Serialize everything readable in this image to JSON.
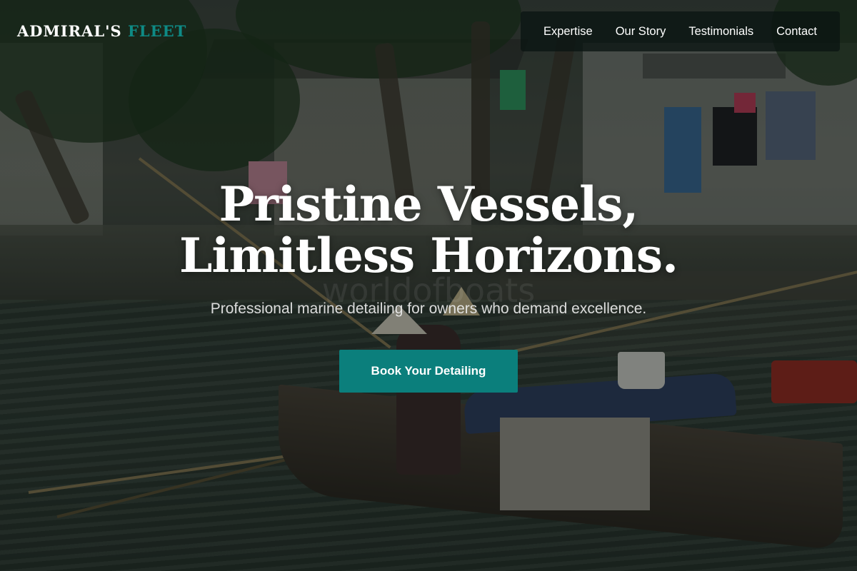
{
  "brand": {
    "logo_main": "ADMIRAL'S",
    "logo_accent": "FLEET",
    "accent_color": "#0e8a85"
  },
  "nav": {
    "items": [
      "Expertise",
      "Our Story",
      "Testimonials",
      "Contact"
    ]
  },
  "hero": {
    "title_line1": "Pristine Vessels,",
    "title_line2": "Limitless Horizons.",
    "watermark": "worldofboats",
    "subtitle": "Professional marine detailing for owners who demand excellence.",
    "cta_label": "Book Your Detailing",
    "cta_color": "#0b7f7c",
    "background_image": "canal-boat-photo"
  }
}
